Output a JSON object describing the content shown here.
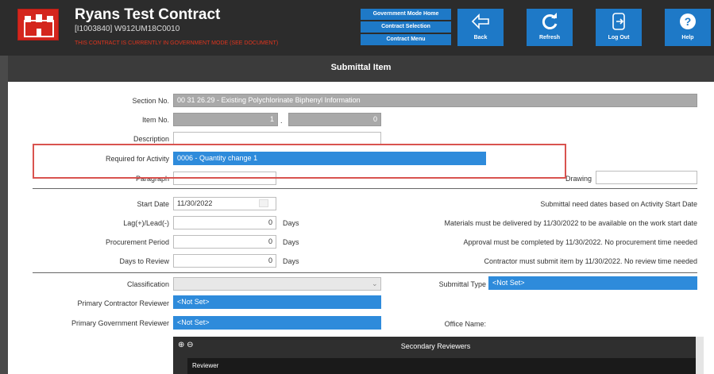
{
  "header": {
    "title": "Ryans Test Contract",
    "subtitle": "[I1003840] W912UM18C0010",
    "warning": "THIS CONTRACT IS CURRENTLY IN GOVERNMENT MODE (SEE DOCUMENT)",
    "nav": [
      "Government Mode Home",
      "Contract Selection",
      "Contract Menu"
    ],
    "tools": [
      {
        "label": "Back",
        "icon": "back-arrow-icon"
      },
      {
        "label": "Refresh",
        "icon": "refresh-icon"
      },
      {
        "label": "Log Out",
        "icon": "logout-icon"
      },
      {
        "label": "Help",
        "icon": "help-icon"
      }
    ]
  },
  "page": {
    "title": "Submittal Item"
  },
  "form": {
    "section_no_label": "Section No.",
    "section_no_value": "00 31 26.29 - Existing Polychlorinate Biphenyl Information",
    "item_no_label": "Item No.",
    "item_no_value": "1",
    "item_sub_value": "0",
    "description_label": "Description",
    "description_value": "",
    "required_label": "Required for Activity",
    "required_value": "0006 - Quantity change 1",
    "paragraph_label": "Paragraph",
    "paragraph_value": "",
    "drawing_label": "Drawing",
    "drawing_value": "",
    "start_date_label": "Start Date",
    "start_date_value": "11/30/2022",
    "lag_label": "Lag(+)/Lead(-)",
    "lag_value": "0",
    "procurement_label": "Procurement Period",
    "procurement_value": "0",
    "review_label": "Days to Review",
    "review_value": "0",
    "days_unit": "Days",
    "notes": [
      "Submittal need dates based on Activity Start Date",
      "Materials must be delivered by 11/30/2022 to be available on the work start date",
      "Approval must be completed by 11/30/2022. No procurement time needed",
      "Contractor must submit item by 11/30/2022. No review time needed"
    ],
    "classification_label": "Classification",
    "classification_value": "",
    "submittal_type_label": "Submittal Type",
    "submittal_type_value": "<Not Set>",
    "primary_contractor_label": "Primary Contractor Reviewer",
    "primary_contractor_value": "<Not Set>",
    "primary_government_label": "Primary Government Reviewer",
    "primary_government_value": "<Not Set>",
    "office_name_label": "Office Name:"
  },
  "secondary": {
    "title": "Secondary Reviewers",
    "column": "Reviewer"
  },
  "colors": {
    "header_bg": "#2c2c2c",
    "accent_blue": "#1e79c7",
    "field_blue": "#2e8bdb",
    "highlight_red": "#d9534f",
    "logo_red": "#d4261d"
  }
}
